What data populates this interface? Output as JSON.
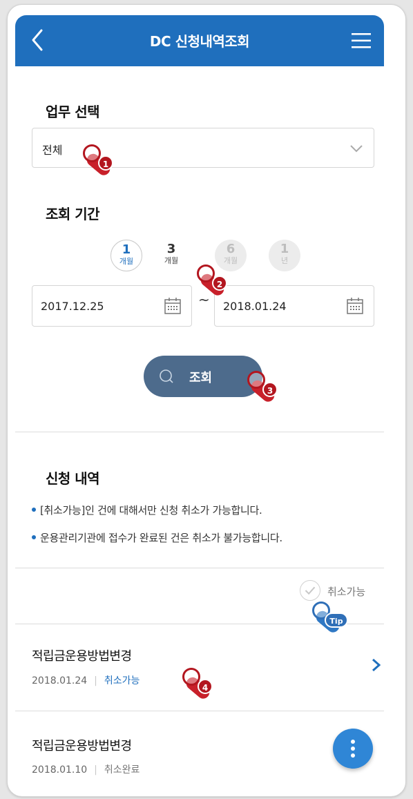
{
  "header": {
    "title": "DC 신청내역조회",
    "back_icon": "chevron-left-icon",
    "menu_icon": "hamburger-menu-icon",
    "bg_color": "#1f6fbd"
  },
  "task_select": {
    "label": "업무 선택",
    "value": "전체"
  },
  "period": {
    "label": "조회 기간",
    "options": [
      {
        "num": "1",
        "unit": "개월",
        "state": "selected"
      },
      {
        "num": "3",
        "unit": "개월",
        "state": "normal"
      },
      {
        "num": "6",
        "unit": "개월",
        "state": "disabled"
      },
      {
        "num": "1",
        "unit": "년",
        "state": "disabled"
      }
    ],
    "start_date": "2017.12.25",
    "separator": "~",
    "end_date": "2018.01.24"
  },
  "search_button": {
    "label": "조회",
    "bg_color": "#4d6b8c"
  },
  "history": {
    "label": "신청 내역",
    "notes": [
      "[취소가능]인 건에 대해서만 신청 취소가 가능합니다.",
      "운용관리기관에 접수가 완료된 건은 취소가 불가능합니다."
    ],
    "filter_label": "취소가능",
    "items": [
      {
        "title": "적립금운용방법변경",
        "date": "2018.01.24",
        "separator": "|",
        "status": "취소가능"
      },
      {
        "title": "적립금운용방법변경",
        "date": "2018.01.10",
        "separator": "|",
        "status": "취소완료"
      }
    ]
  },
  "tutorial_markers": [
    "1",
    "2",
    "3",
    "4",
    "Tip"
  ]
}
